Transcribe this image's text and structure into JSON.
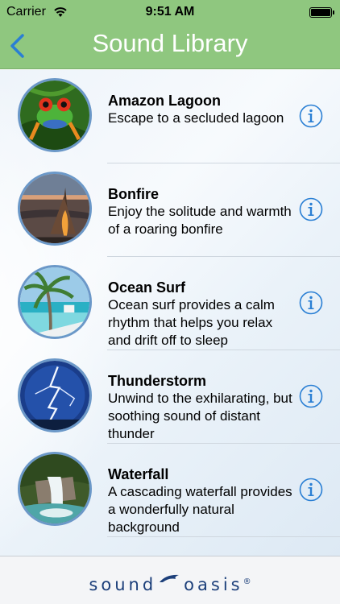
{
  "status_bar": {
    "carrier": "Carrier",
    "time": "9:51 AM",
    "icons": [
      "wifi-icon",
      "battery-icon"
    ]
  },
  "nav": {
    "title": "Sound Library",
    "back_icon": "chevron-left-icon",
    "accent": "#8fc77f"
  },
  "sounds": [
    {
      "name": "Amazon Lagoon",
      "desc": "Escape to a secluded lagoon",
      "thumbnail": "frog"
    },
    {
      "name": "Bonfire",
      "desc": "Enjoy the solitude and warmth of a roaring bonfire",
      "thumbnail": "bonfire"
    },
    {
      "name": "Ocean Surf",
      "desc": "Ocean surf provides a calm rhythm that helps you relax and drift off to sleep",
      "thumbnail": "palm"
    },
    {
      "name": "Thunderstorm",
      "desc": "Unwind to the exhilarating, but soothing sound of distant thunder",
      "thumbnail": "lightning"
    },
    {
      "name": "Waterfall",
      "desc": "A cascading waterfall provides a wonderfully natural background",
      "thumbnail": "waterfall"
    }
  ],
  "info_icon": "info-icon",
  "info_color": "#2a7fd4",
  "footer": {
    "logo_left": "sound",
    "logo_right": "oasis",
    "logo_mark": "®"
  }
}
